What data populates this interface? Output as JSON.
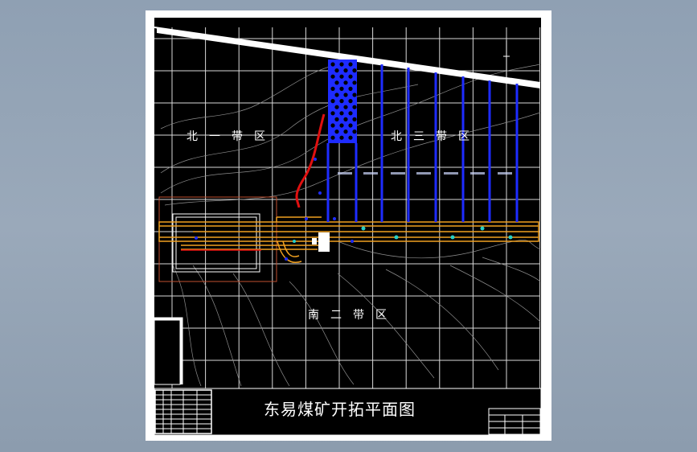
{
  "drawing": {
    "title": "东易煤矿开拓平面图",
    "zones": {
      "north_one": "北一带区",
      "north_three": "北三带区",
      "south_two": "南二带区"
    }
  },
  "colors": {
    "background": "#000000",
    "sheet": "#ffffff",
    "grid": "#ffffff",
    "contour": "#9a9a9a",
    "roadway": "#f0a020",
    "panel_entry": "#1e2cff",
    "gob_hatch": "#2b3cff",
    "fault": "#e01010",
    "boundary": "#c05030",
    "markers": "#25d0c8"
  }
}
